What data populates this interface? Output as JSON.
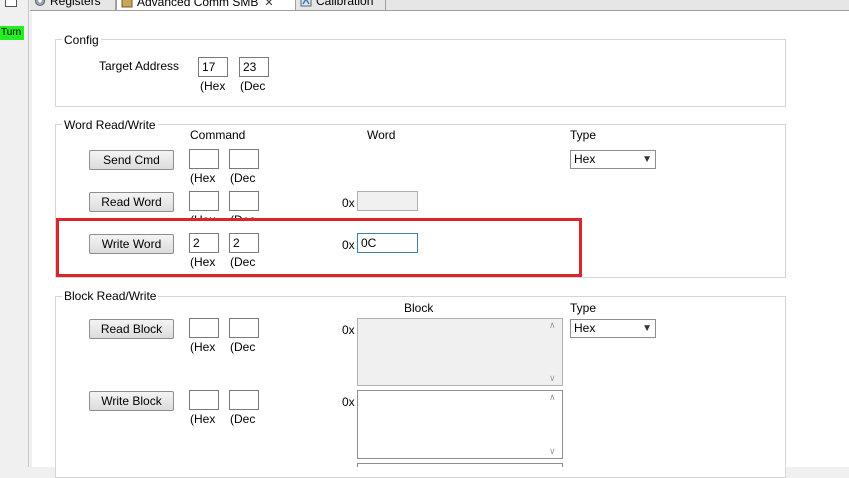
{
  "tabs": [
    {
      "label": "Registers",
      "icon": "gear-icon",
      "active": false
    },
    {
      "label": "Advanced Comm SMB",
      "icon": "package-icon",
      "active": true
    },
    {
      "label": "Calibration",
      "icon": "calibration-icon",
      "active": false
    }
  ],
  "side_badge": "Turn",
  "config": {
    "title": "Config",
    "target_label": "Target Address",
    "hex_value": "17",
    "dec_value": "23",
    "hex_unit": "(Hex",
    "dec_unit": "(Dec"
  },
  "word_rw": {
    "title": "Word Read/Write",
    "col_command": "Command",
    "col_word": "Word",
    "col_type": "Type",
    "send_cmd": {
      "label": "Send Cmd",
      "hex": "",
      "dec": ""
    },
    "read_word": {
      "label": "Read Word",
      "hex": "",
      "dec": "",
      "prefix": "0x",
      "value": ""
    },
    "write_word": {
      "label": "Write Word",
      "hex": "2",
      "dec": "2",
      "prefix": "0x",
      "value": "0C"
    },
    "hex_unit": "(Hex",
    "dec_unit": "(Dec",
    "type_value": "Hex"
  },
  "block_rw": {
    "title": "Block Read/Write",
    "col_block": "Block",
    "col_type": "Type",
    "read_block": {
      "label": "Read Block",
      "hex": "",
      "dec": "",
      "prefix": "0x"
    },
    "write_block": {
      "label": "Write Block",
      "hex": "",
      "dec": "",
      "prefix": "0x"
    },
    "hex_unit": "(Hex",
    "dec_unit": "(Dec",
    "type_value": "Hex"
  },
  "colors": {
    "highlight": "#d9262e",
    "badge": "#22ee22"
  }
}
